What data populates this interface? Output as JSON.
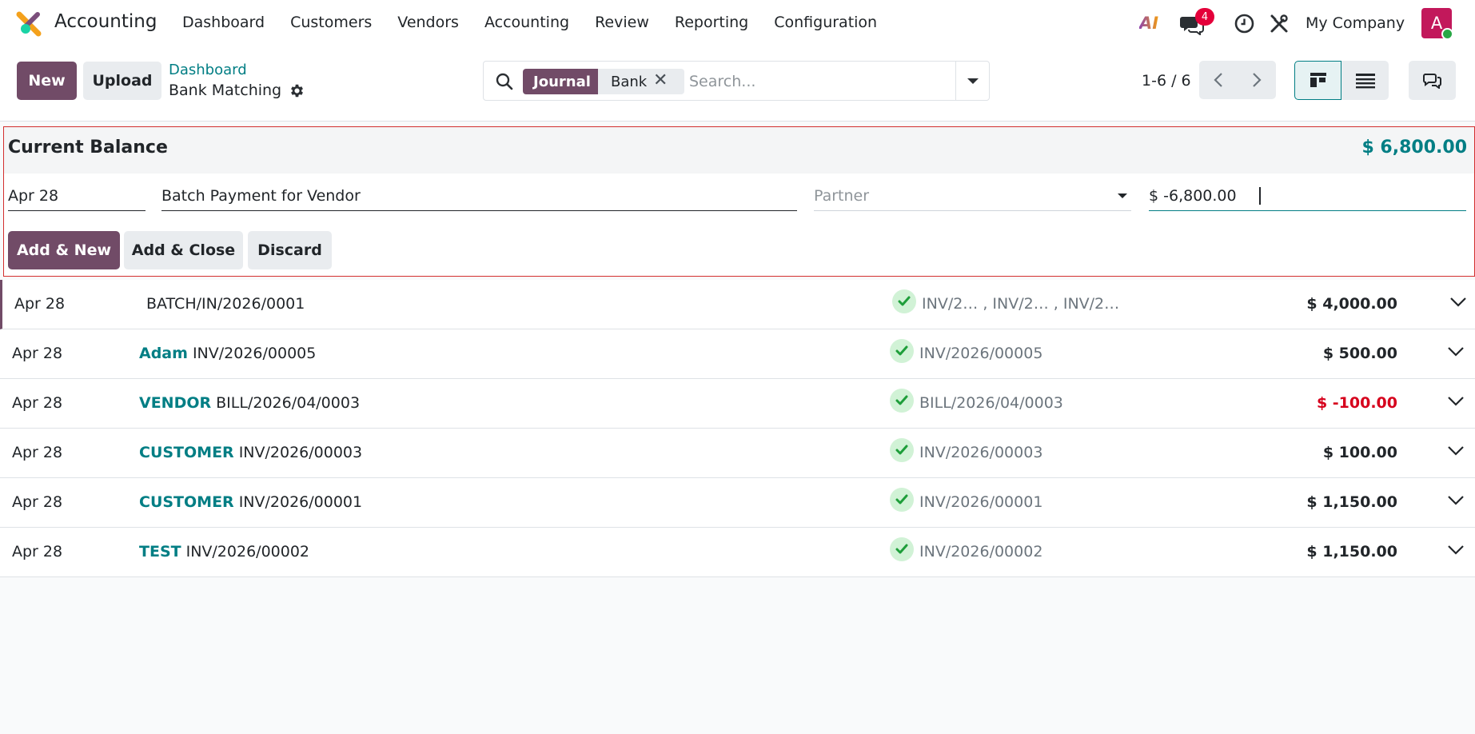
{
  "navbar": {
    "app_name": "Accounting",
    "menu": [
      "Dashboard",
      "Customers",
      "Vendors",
      "Accounting",
      "Review",
      "Reporting",
      "Configuration"
    ],
    "ai_label": "AI",
    "chat_badge": "4",
    "company": "My Company",
    "avatar_letter": "A"
  },
  "control": {
    "new_label": "New",
    "upload_label": "Upload",
    "breadcrumb_parent": "Dashboard",
    "breadcrumb_current": "Bank Matching",
    "search": {
      "facet_label": "Journal",
      "facet_value": "Bank",
      "placeholder": "Search..."
    },
    "pager": "1-6 / 6"
  },
  "quick_create": {
    "title": "Current Balance",
    "balance": "$ 6,800.00",
    "date": "Apr 28",
    "label": "Batch Payment for Vendor",
    "partner_placeholder": "Partner",
    "amount": "$ -6,800.00",
    "add_new": "Add & New",
    "add_close": "Add & Close",
    "discard": "Discard"
  },
  "lines": [
    {
      "date": "Apr 28",
      "partner": "",
      "label": "BATCH/IN/2026/0001",
      "refs": "INV/2…   , INV/2…   , INV/2…",
      "amount": "$ 4,000.00",
      "negative": false
    },
    {
      "date": "Apr 28",
      "partner": "Adam",
      "label": "INV/2026/00005",
      "refs": "INV/2026/00005",
      "amount": "$ 500.00",
      "negative": false
    },
    {
      "date": "Apr 28",
      "partner": "VENDOR",
      "label": "BILL/2026/04/0003",
      "refs": "BILL/2026/04/0003",
      "amount": "$ -100.00",
      "negative": true
    },
    {
      "date": "Apr 28",
      "partner": "CUSTOMER",
      "label": "INV/2026/00003",
      "refs": "INV/2026/00003",
      "amount": "$ 100.00",
      "negative": false
    },
    {
      "date": "Apr 28",
      "partner": "CUSTOMER",
      "label": "INV/2026/00001",
      "refs": "INV/2026/00001",
      "amount": "$ 1,150.00",
      "negative": false
    },
    {
      "date": "Apr 28",
      "partner": "TEST",
      "label": "INV/2026/00002",
      "refs": "INV/2026/00002",
      "amount": "$ 1,150.00",
      "negative": false
    }
  ],
  "colors": {
    "primary": "#714b67",
    "accent": "#017e84",
    "negative": "#d6001c",
    "reconciled": "#28a745"
  }
}
